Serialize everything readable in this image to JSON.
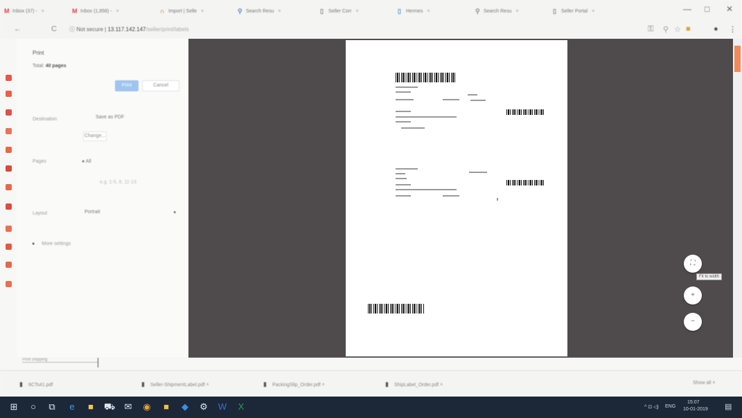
{
  "tabs": [
    {
      "label": "Inbox (37) -",
      "icon": "gmail-icon"
    },
    {
      "label": "Inbox (1,858) -",
      "icon": "gmail-icon"
    },
    {
      "label": "Import | Selle",
      "icon": "amazon-icon"
    },
    {
      "label": "Search Resu",
      "icon": "search-icon"
    },
    {
      "label": "Seller Corr",
      "icon": "page-icon"
    },
    {
      "label": "Hermes",
      "icon": "page-icon"
    },
    {
      "label": "Search Resu",
      "icon": "page-icon"
    },
    {
      "label": "Seller Portal",
      "icon": "page-icon"
    }
  ],
  "window": {
    "minimize": "—",
    "maximize": "□",
    "close": "✕"
  },
  "address": {
    "back": "←",
    "reload": "C",
    "secure": "ⓘ Not secure |",
    "host": "13.117.142.147",
    "path": "/seller/print/labels",
    "star": "☆",
    "menu": "⋮"
  },
  "print": {
    "title": "Print",
    "total_label": "Total:",
    "total_value": "40 pages",
    "print_button": "Print",
    "cancel_button": "Cancel",
    "destination_label": "Destination",
    "destination_value": "Save as PDF",
    "change_button": "Change...",
    "pages_label": "Pages",
    "pages_value": "All",
    "pages_example": "e.g. 1-5, 8, 11-13",
    "layout_label": "Layout",
    "layout_value": "Portrait",
    "more_settings": "More settings",
    "bottom_label": "Print shipping"
  },
  "preview": {
    "zoom_fit": "⛶",
    "zoom_in": "+",
    "zoom_out": "−",
    "tooltip": "Fit to width"
  },
  "downloads": {
    "items": [
      {
        "name": "6CTs41.pdf"
      },
      {
        "name": "Seller-ShipmentLabel.pdf"
      },
      {
        "name": "PackingSlip_Order.pdf"
      },
      {
        "name": "ShipLabel_Order.pdf"
      }
    ],
    "show_all": "Show all"
  },
  "taskbar": {
    "apps": [
      "windows-icon",
      "search-icon",
      "taskview-icon",
      "edge-icon",
      "explorer-icon",
      "store-icon",
      "mail-icon",
      "chrome-icon",
      "files-icon",
      "photos-icon",
      "settings-icon",
      "word-icon",
      "excel-icon"
    ],
    "language": "ENG",
    "time": "15:07",
    "date": "10-01-2019"
  }
}
